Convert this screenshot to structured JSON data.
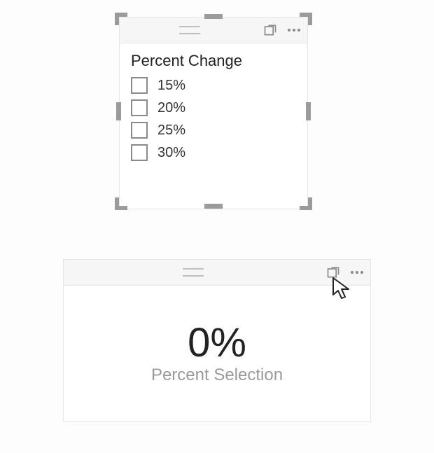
{
  "slicer": {
    "title": "Percent Change",
    "items": [
      {
        "label": "15%",
        "checked": false
      },
      {
        "label": "20%",
        "checked": false
      },
      {
        "label": "25%",
        "checked": false
      },
      {
        "label": "30%",
        "checked": false
      }
    ],
    "header": {
      "focus_tooltip": "Focus mode",
      "more_tooltip": "More options"
    }
  },
  "card": {
    "value": "0%",
    "label": "Percent Selection",
    "header": {
      "focus_tooltip": "Focus mode",
      "more_tooltip": "More options"
    }
  }
}
